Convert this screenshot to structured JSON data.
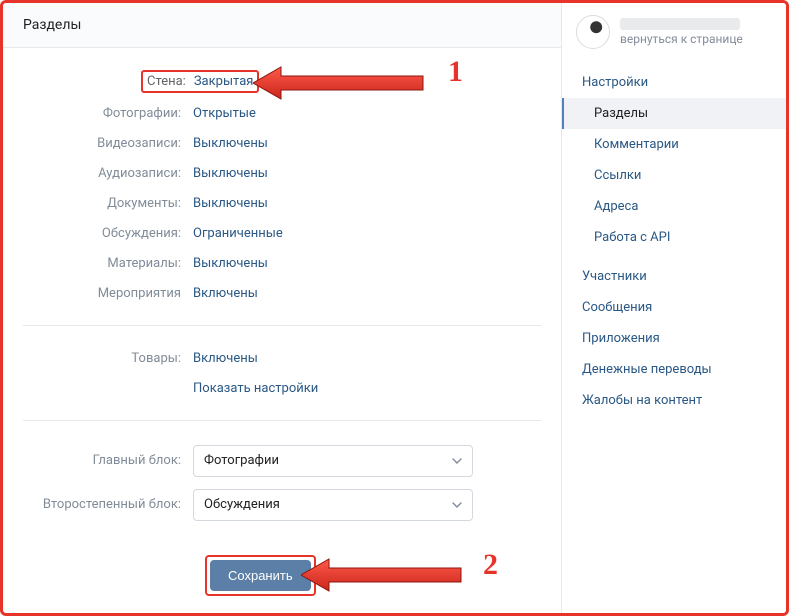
{
  "header": {
    "title": "Разделы"
  },
  "settings": [
    {
      "label": "Стена:",
      "value": "Закрытая",
      "highlighted": true
    },
    {
      "label": "Фотографии:",
      "value": "Открытые"
    },
    {
      "label": "Видеозаписи:",
      "value": "Выключены"
    },
    {
      "label": "Аудиозаписи:",
      "value": "Выключены"
    },
    {
      "label": "Документы:",
      "value": "Выключены"
    },
    {
      "label": "Обсуждения:",
      "value": "Ограниченные"
    },
    {
      "label": "Материалы:",
      "value": "Выключены"
    },
    {
      "label": "Мероприятия",
      "value": "Включены"
    }
  ],
  "goods": {
    "label": "Товары:",
    "value": "Включены",
    "settings_link": "Показать настройки"
  },
  "blocks": {
    "main": {
      "label": "Главный блок:",
      "value": "Фотографии"
    },
    "secondary": {
      "label": "Второстепенный блок:",
      "value": "Обсуждения"
    }
  },
  "save_label": "Сохранить",
  "sidebar": {
    "back_label": "вернуться к странице",
    "items": [
      {
        "label": "Настройки",
        "sub": false,
        "active": false
      },
      {
        "label": "Разделы",
        "sub": true,
        "active": true
      },
      {
        "label": "Комментарии",
        "sub": true,
        "active": false
      },
      {
        "label": "Ссылки",
        "sub": true,
        "active": false
      },
      {
        "label": "Адреса",
        "sub": true,
        "active": false
      },
      {
        "label": "Работа с API",
        "sub": true,
        "active": false
      },
      {
        "label": "Участники",
        "sub": false,
        "active": false
      },
      {
        "label": "Сообщения",
        "sub": false,
        "active": false
      },
      {
        "label": "Приложения",
        "sub": false,
        "active": false
      },
      {
        "label": "Денежные переводы",
        "sub": false,
        "active": false
      },
      {
        "label": "Жалобы на контент",
        "sub": false,
        "active": false
      }
    ]
  },
  "annotations": {
    "n1": "1",
    "n2": "2"
  },
  "colors": {
    "accent": "#2a5885",
    "annotation": "#e7342a",
    "button": "#5b7fa6"
  }
}
